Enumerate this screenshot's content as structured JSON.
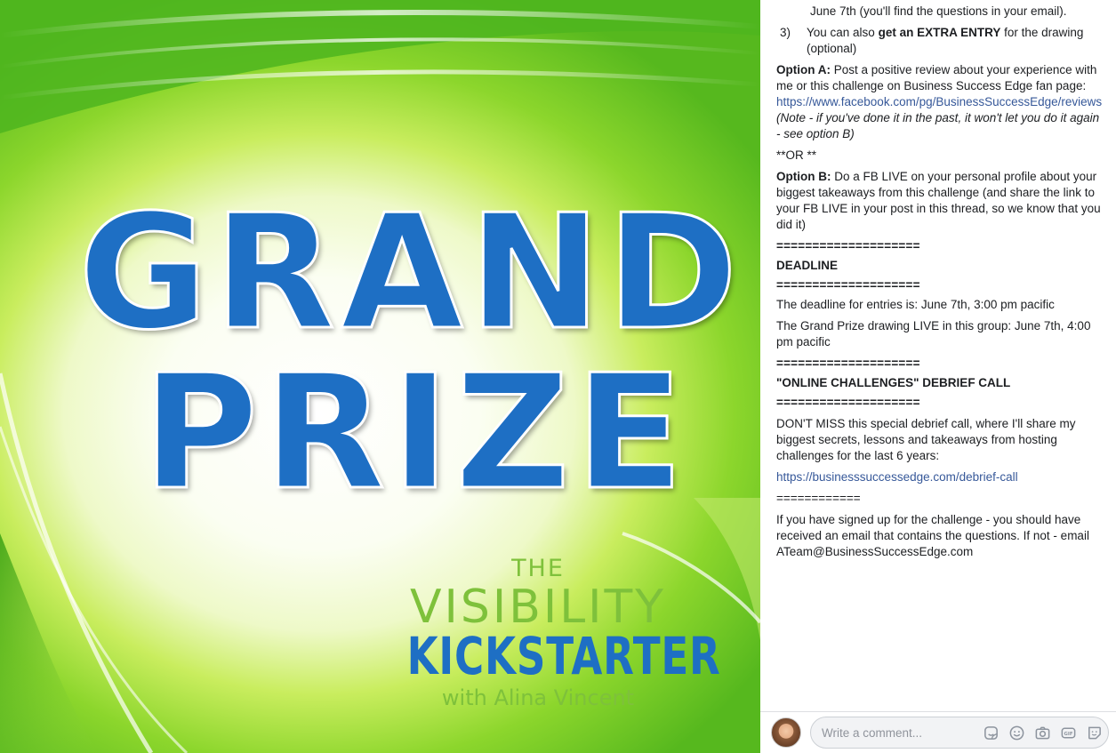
{
  "graphic": {
    "headline_line1": "GRAND",
    "headline_line2": "PRIZE",
    "logo_the": "THE",
    "logo_visibility": "VISIBILITY",
    "logo_kickstarter": "KICKSTARTER",
    "logo_with": "with Alina Vincent"
  },
  "post": {
    "continuation_line": "June 7th (you'll find the questions in your email).",
    "item3_num": "3)",
    "item3_pre": "You can also ",
    "item3_bold": "get an EXTRA ENTRY",
    "item3_post": " for the drawing (optional)",
    "optionA_label": "Option A:",
    "optionA_text": " Post a positive review about your experience with me or this challenge on Business Success Edge fan page:",
    "optionA_link": "https://www.facebook.com/pg/BusinessSuccessEdge/reviews",
    "optionA_note": "(Note - if you've done it in the past, it won't let you do it again - see option B)",
    "or_text": "**OR **",
    "optionB_label": "Option B:",
    "optionB_text": " Do a FB LIVE on your personal profile about your biggest takeaways from this challenge (and share the link to your FB LIVE in your post in this thread, so we know that you did it)",
    "separator": "====================",
    "deadline_heading": "DEADLINE",
    "deadline_text1": "The deadline for entries is: June 7th, 3:00 pm pacific",
    "deadline_text2": "The Grand Prize drawing LIVE in this group: June 7th, 4:00 pm pacific",
    "debrief_heading": "\"ONLINE CHALLENGES\" DEBRIEF CALL",
    "debrief_text": "DON'T MISS this special debrief call, where I'll share my biggest secrets, lessons and takeaways from hosting challenges for the last 6 years:",
    "debrief_link": "https://businesssuccessedge.com/debrief-call",
    "short_separator": "============",
    "signup_text": "If you have signed up for the challenge - you should have received an email that contains the questions. If not - email ATeam@BusinessSuccessEdge.com"
  },
  "comment": {
    "placeholder": "Write a comment...",
    "icons": [
      "sticker-face-icon",
      "emoji-icon",
      "camera-icon",
      "gif-icon",
      "sticker-icon"
    ]
  },
  "colors": {
    "link": "#365899",
    "headline_blue": "#1e6fc4",
    "logo_green": "#7ec13b"
  }
}
